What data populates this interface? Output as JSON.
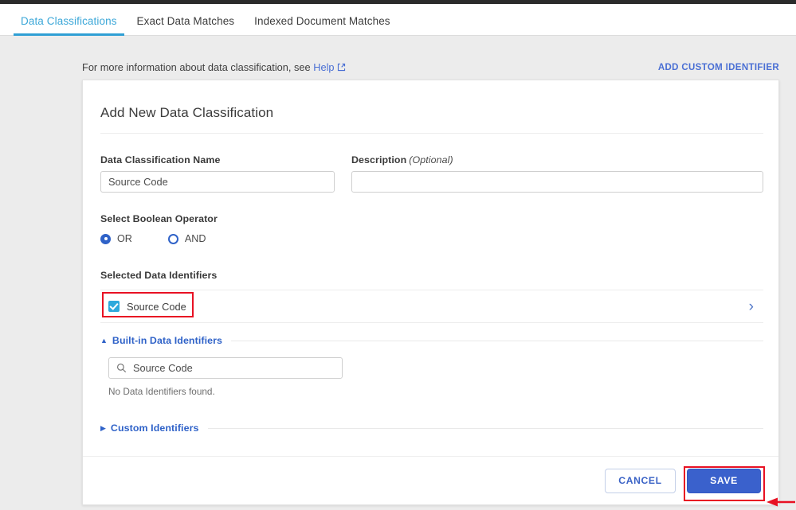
{
  "tabs": [
    {
      "label": "Data Classifications",
      "active": true
    },
    {
      "label": "Exact Data Matches",
      "active": false
    },
    {
      "label": "Indexed Document Matches",
      "active": false
    }
  ],
  "info": {
    "text": "For more information about data classification, see",
    "help_label": "Help",
    "external_icon": "external-link-icon"
  },
  "actions": {
    "add_custom_identifier": "ADD CUSTOM IDENTIFIER"
  },
  "card": {
    "title": "Add New Data Classification",
    "name_field": {
      "label": "Data Classification Name",
      "value": "Source Code",
      "placeholder": ""
    },
    "description_field": {
      "label": "Description",
      "optional_label": "(Optional)",
      "value": "",
      "placeholder": ""
    },
    "boolean_operator": {
      "label": "Select Boolean Operator",
      "options": [
        {
          "label": "OR",
          "selected": true
        },
        {
          "label": "AND",
          "selected": false
        }
      ]
    },
    "selected_identifiers": {
      "label": "Selected Data Identifiers",
      "items": [
        {
          "name": "Source Code",
          "checked": true,
          "chevron": "chevron-right-icon"
        }
      ]
    },
    "builtin_section": {
      "title": "Built-in Data Identifiers",
      "expanded": true,
      "caret": "caret-up-icon",
      "search": {
        "icon": "search-icon",
        "value": "Source Code",
        "placeholder": "Search"
      },
      "empty_text": "No Data Identifiers found."
    },
    "custom_section": {
      "title": "Custom Identifiers",
      "expanded": false,
      "caret": "caret-right-icon"
    },
    "footer": {
      "cancel_label": "CANCEL",
      "save_label": "SAVE"
    }
  },
  "annotations": {
    "checkbox_highlight": "red-rectangle",
    "save_highlight": "red-rectangle",
    "save_arrow": "red-arrow-left"
  },
  "colors": {
    "tab_active": "#2f9fd4",
    "link_blue": "#4a6fd4",
    "accent_blue": "#2f62c8",
    "save_blue": "#3a61cc",
    "checkbox_blue": "#2ea9dc",
    "annotation_red": "#e81123",
    "page_bg": "#ececec"
  }
}
